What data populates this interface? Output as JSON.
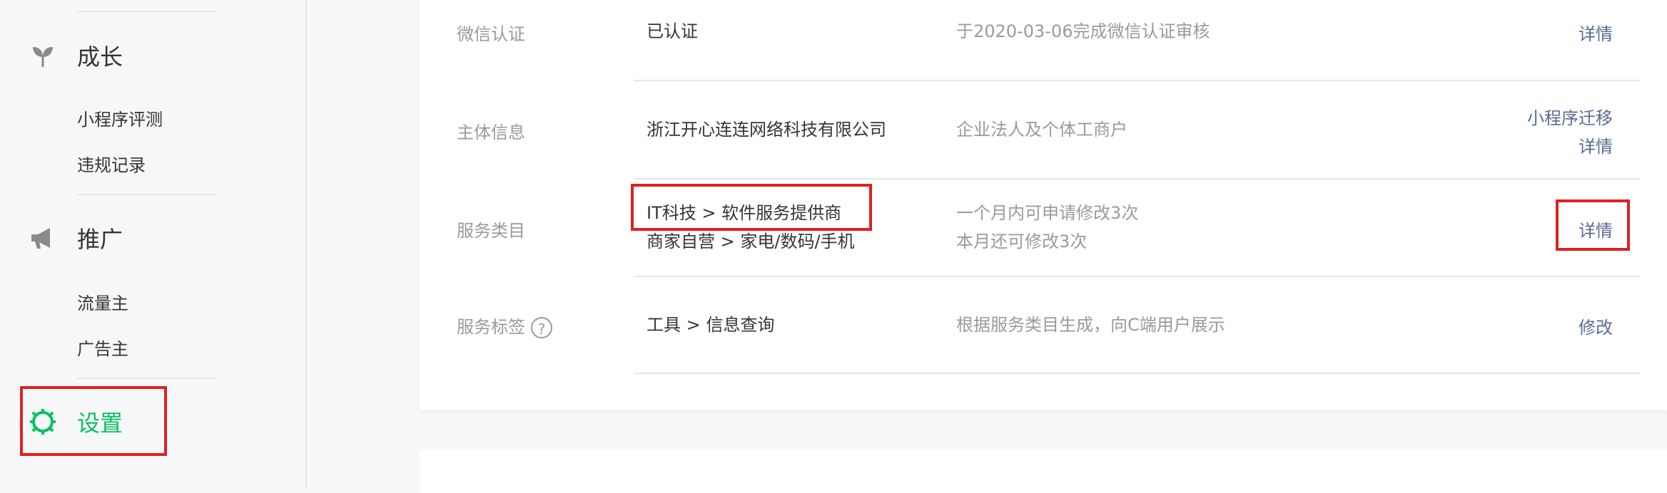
{
  "sidebar": {
    "growth": {
      "label": "成长",
      "icon": "sprout-icon",
      "items": [
        {
          "label": "小程序评测"
        },
        {
          "label": "违规记录"
        }
      ]
    },
    "promotion": {
      "label": "推广",
      "icon": "megaphone-icon",
      "items": [
        {
          "label": "流量主"
        },
        {
          "label": "广告主"
        }
      ]
    },
    "settings": {
      "label": "设置",
      "icon": "gear-icon",
      "color": "#07c160"
    }
  },
  "info_rows": [
    {
      "label": "微信认证",
      "value": [
        "已认证"
      ],
      "desc": [
        "于2020-03-06完成微信认证审核"
      ],
      "actions": [
        "详情"
      ]
    },
    {
      "label": "主体信息",
      "value": [
        "浙江开心连连网络科技有限公司"
      ],
      "desc": [
        "企业法人及个体工商户"
      ],
      "actions": [
        "小程序迁移",
        "详情"
      ]
    },
    {
      "label": "服务类目",
      "value": [
        "IT科技 > 软件服务提供商",
        "商家自营 > 家电/数码/手机"
      ],
      "desc": [
        "一个月内可申请修改3次",
        "本月还可修改3次"
      ],
      "actions": [
        "详情"
      ]
    },
    {
      "label": "服务标签",
      "help": "?",
      "value": [
        "工具 > 信息查询"
      ],
      "desc": [
        "根据服务类目生成，向C端用户展示"
      ],
      "actions": [
        "修改"
      ]
    }
  ],
  "colors": {
    "link": "#576b95",
    "accent": "#07c160",
    "highlight": "#e02020"
  }
}
